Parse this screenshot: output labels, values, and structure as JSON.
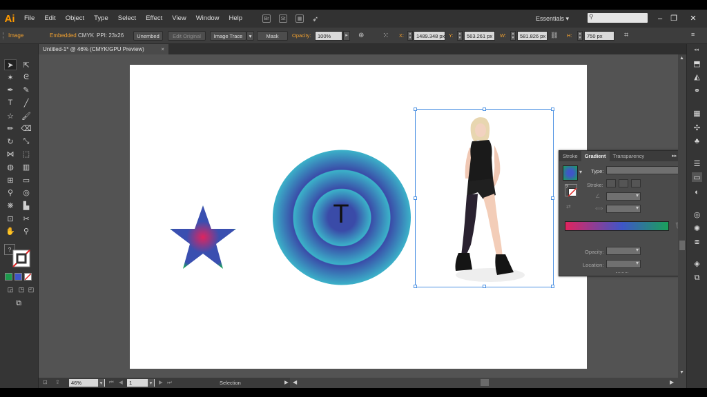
{
  "app": {
    "logo": "Ai",
    "menu": [
      "File",
      "Edit",
      "Object",
      "Type",
      "Select",
      "Effect",
      "View",
      "Window",
      "Help"
    ],
    "workspace": "Essentials",
    "workspace_chevron": "▾",
    "window_controls": [
      "–",
      "❐",
      "✕"
    ]
  },
  "control_bar": {
    "object_type": "Image",
    "embedded": "Embedded",
    "color_mode": "CMYK",
    "ppi": "PPI: 23x26",
    "unembed": "Unembed",
    "edit_original": "Edit Original",
    "image_trace": "Image Trace",
    "mask": "Mask",
    "opacity_label": "Opacity:",
    "opacity_value": "100%",
    "x_label": "X:",
    "x_value": "1489.348 px",
    "y_label": "Y:",
    "y_value": "563.261 px",
    "w_label": "W:",
    "w_value": "581.826 px",
    "h_label": "H:",
    "h_value": "750 px"
  },
  "document": {
    "tab_title": "Untitled-1* @ 46% (CMYK/GPU Preview)",
    "close": "×"
  },
  "artboard": {
    "circle_text": "T"
  },
  "gradient_panel": {
    "tabs": [
      "Stroke",
      "Gradient",
      "Transparency"
    ],
    "type_label": "Type:",
    "stroke_label": "Stroke:",
    "opacity_label": "Opacity:",
    "location_label": "Location:",
    "gradient_colors": [
      "#e0245e",
      "#3f56c8",
      "#1aa15a"
    ]
  },
  "status": {
    "zoom": "46%",
    "page": "1",
    "tool": "Selection"
  },
  "colors": {
    "accent": "#f0a030",
    "selection": "#4a90e2",
    "star_center": "#e0245e",
    "star_edge": "#3a4fb0",
    "circle_light": "#3bb2c9",
    "circle_dark": "#3a4ba8"
  }
}
